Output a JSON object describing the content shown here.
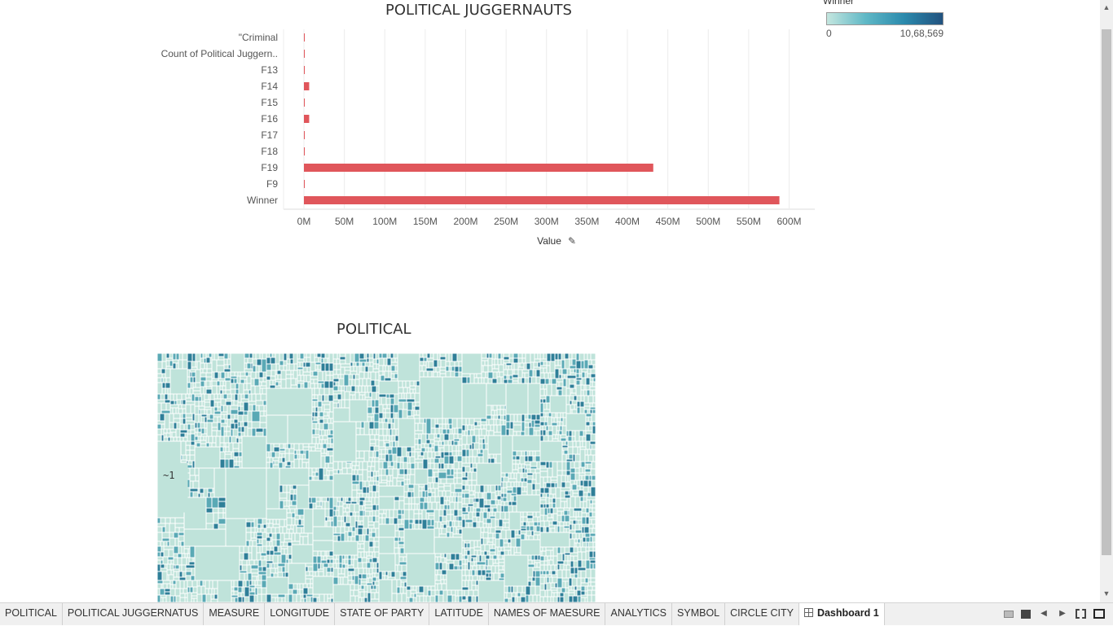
{
  "bar_chart": {
    "title": "POLITICAL JUGGERNAUTS",
    "bar_color": "#e0565b",
    "chart_data": {
      "type": "bar",
      "orientation": "horizontal",
      "categories": [
        "\"Criminal",
        "Count of Political Juggern..",
        "F13",
        "F14",
        "F15",
        "F16",
        "F17",
        "F18",
        "F19",
        "F9",
        "Winner"
      ],
      "values": [
        0.5,
        0.3,
        0.3,
        6.5,
        0.3,
        6.5,
        0.3,
        0.3,
        432,
        0.3,
        588
      ],
      "value_unit": "M",
      "xlabel": "Value",
      "xticks": [
        "0M",
        "50M",
        "100M",
        "150M",
        "200M",
        "250M",
        "300M",
        "350M",
        "400M",
        "450M",
        "500M",
        "550M",
        "600M"
      ],
      "xlim": [
        0,
        630
      ],
      "grid": true
    }
  },
  "legend": {
    "title": "Winner",
    "min_label": "0",
    "max_label": "10,68,569",
    "colors": [
      "#c4e6df",
      "#5fb8c6",
      "#2b8aad",
      "#22527f"
    ]
  },
  "treemap": {
    "title": "POLITICAL",
    "visible_label": "~1",
    "light_color": "#bfe3da",
    "mid_color": "#5aa9b5",
    "dark_color": "#2f7f98"
  },
  "tabs": [
    {
      "label": "POLITICAL",
      "active": false
    },
    {
      "label": "POLITICAL JUGGERNATUS",
      "active": false
    },
    {
      "label": "MEASURE",
      "active": false
    },
    {
      "label": "LONGITUDE",
      "active": false
    },
    {
      "label": "STATE OF PARTY",
      "active": false
    },
    {
      "label": "LATITUDE",
      "active": false
    },
    {
      "label": "NAMES OF MAESURE",
      "active": false
    },
    {
      "label": "ANALYTICS",
      "active": false
    },
    {
      "label": "SYMBOL",
      "active": false
    },
    {
      "label": "CIRCLE CITY",
      "active": false
    },
    {
      "label": "Dashboard 1",
      "active": true
    }
  ],
  "controls": {
    "show_filmstrip_icon": "filmstrip-icon",
    "show_tabs_icon": "tabs-icon",
    "prev_icon": "prev-arrow-icon",
    "next_icon": "next-arrow-icon",
    "fullscreen_icon": "fullscreen-icon",
    "presentation_icon": "presentation-icon"
  }
}
